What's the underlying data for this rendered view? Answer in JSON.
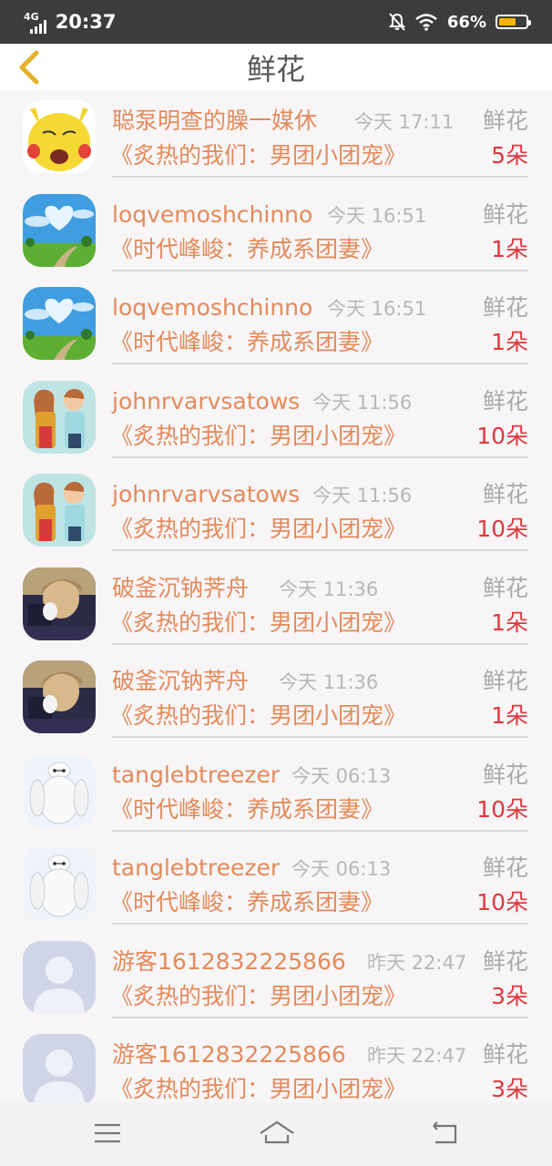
{
  "status_bar": {
    "network": "4G",
    "time": "20:37",
    "battery_percent": "66%",
    "battery_level": 0.66,
    "icons": [
      "signal-icon",
      "mute-bell-icon",
      "wifi-icon",
      "battery-icon"
    ]
  },
  "header": {
    "title": "鲜花",
    "back_icon": "chevron-left-icon"
  },
  "colors": {
    "accent": "#e48a5b",
    "count": "#e0373e",
    "muted": "#aaaaaa",
    "battery": "#f4b400"
  },
  "items": [
    {
      "name": "聪泵明查的臊一媒休",
      "time": "今天 17:11",
      "gift": "鲜花",
      "book": "《炙热的我们：男团小团宠》",
      "count": "5朵",
      "avatar": "yellow-cartoon-avatar"
    },
    {
      "name": "loqvemoshchinno",
      "time": "今天 16:51",
      "gift": "鲜花",
      "book": "《时代峰峻：养成系团妻》",
      "count": "1朵",
      "avatar": "heart-sky-avatar"
    },
    {
      "name": "loqvemoshchinno",
      "time": "今天 16:51",
      "gift": "鲜花",
      "book": "《时代峰峻：养成系团妻》",
      "count": "1朵",
      "avatar": "heart-sky-avatar"
    },
    {
      "name": "johnrvarvsatows",
      "time": "今天 11:56",
      "gift": "鲜花",
      "book": "《炙热的我们：男团小团宠》",
      "count": "10朵",
      "avatar": "couple-illustration-avatar"
    },
    {
      "name": "johnrvarvsatows",
      "time": "今天 11:56",
      "gift": "鲜花",
      "book": "《炙热的我们：男团小团宠》",
      "count": "10朵",
      "avatar": "couple-illustration-avatar"
    },
    {
      "name": "破釜沉钠荠舟",
      "time": "今天 11:36",
      "gift": "鲜花",
      "book": "《炙热的我们：男团小团宠》",
      "count": "1朵",
      "avatar": "dark-photo-avatar"
    },
    {
      "name": "破釜沉钠荠舟",
      "time": "今天 11:36",
      "gift": "鲜花",
      "book": "《炙热的我们：男团小团宠》",
      "count": "1朵",
      "avatar": "dark-photo-avatar"
    },
    {
      "name": "tanglebtreezer",
      "time": "今天 06:13",
      "gift": "鲜花",
      "book": "《时代峰峻：养成系团妻》",
      "count": "10朵",
      "avatar": "white-robot-avatar"
    },
    {
      "name": "tanglebtreezer",
      "time": "今天 06:13",
      "gift": "鲜花",
      "book": "《时代峰峻：养成系团妻》",
      "count": "10朵",
      "avatar": "white-robot-avatar"
    },
    {
      "name": "游客1612832225866",
      "time": "昨天 22:47",
      "gift": "鲜花",
      "book": "《炙热的我们：男团小团宠》",
      "count": "3朵",
      "avatar": "default-person-avatar"
    },
    {
      "name": "游客1612832225866",
      "time": "昨天 22:47",
      "gift": "鲜花",
      "book": "《炙热的我们：男团小团宠》",
      "count": "3朵",
      "avatar": "default-person-avatar"
    }
  ],
  "nav_bar": {
    "icons": [
      "menu-icon",
      "home-icon",
      "back-icon"
    ]
  }
}
